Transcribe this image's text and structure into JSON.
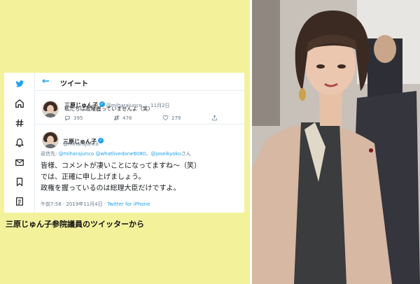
{
  "header": {
    "back_icon": "arrow-left-icon",
    "title": "ツイート"
  },
  "rail": {
    "icons": [
      "twitter-bird-icon",
      "home-icon",
      "hashtag-icon",
      "bell-icon",
      "mail-icon",
      "bookmark-icon",
      "list-icon"
    ]
  },
  "tweet1": {
    "name": "三原じゅん子",
    "handle": "@miharajunco",
    "dot": "·",
    "date": "11月2日",
    "text": "私たちは政権握っていませんよ（笑）",
    "reply_count": "395",
    "retweet_count": "478",
    "like_count": "279"
  },
  "tweet2": {
    "name": "三原じゅん子",
    "handle": "@miharajunco",
    "reply_prefix": "返信先:",
    "reply_m1": "@miharajunco",
    "reply_m2": "@whatlivedone6080",
    "reply_sep": "、",
    "reply_m3": "@joseikyoku",
    "reply_suffix": "さん",
    "lines": [
      "皆様、コメントが凄いことになってますね～（笑）",
      "では、正確に申し上げましょう。",
      "政権を握っているのは総理大臣だけですよ。"
    ],
    "time": "午前7:58 · 2019年11月4日 ·",
    "source": "Twitter for iPhone"
  },
  "caption": "三原じゅん子参院議員のツイッターから",
  "colors": {
    "left_bg": "#f3f29b",
    "twitter_blue": "#1da1f2",
    "gray_text": "#657786"
  }
}
